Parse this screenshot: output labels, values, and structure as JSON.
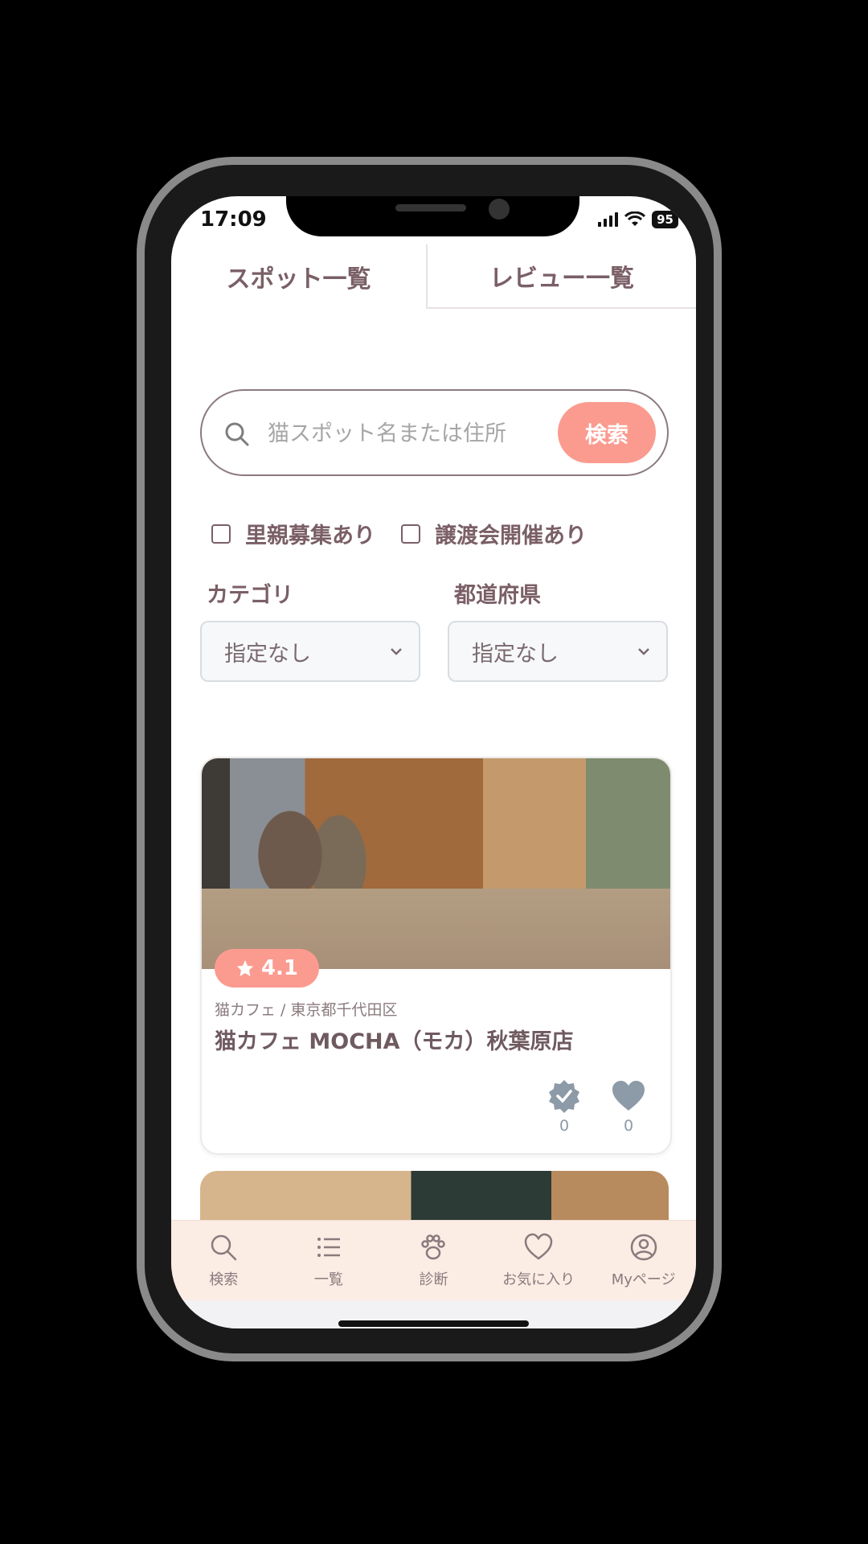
{
  "status": {
    "time": "17:09",
    "battery": "95"
  },
  "tabs": [
    {
      "label": "スポット一覧"
    },
    {
      "label": "レビュー一覧"
    }
  ],
  "search": {
    "placeholder": "猫スポット名または住所",
    "button_label": "検索"
  },
  "filters": {
    "checkboxes": [
      {
        "label": "里親募集あり"
      },
      {
        "label": "譲渡会開催あり"
      }
    ],
    "category": {
      "label": "カテゴリ",
      "value": "指定なし"
    },
    "prefecture": {
      "label": "都道府県",
      "value": "指定なし"
    }
  },
  "cards": [
    {
      "rating": "4.1",
      "meta": "猫カフェ / 東京都千代田区",
      "title": "猫カフェ MOCHA（モカ）秋葉原店",
      "visited_count": "0",
      "favorite_count": "0"
    }
  ],
  "nav": [
    {
      "label": "検索",
      "icon": "search-icon"
    },
    {
      "label": "一覧",
      "icon": "list-icon"
    },
    {
      "label": "診断",
      "icon": "paw-icon"
    },
    {
      "label": "お気に入り",
      "icon": "heart-icon"
    },
    {
      "label": "Myページ",
      "icon": "user-icon"
    }
  ],
  "colors": {
    "accent": "#fb9b8f",
    "text": "#7a5f66",
    "nav_bg": "#fbece4"
  }
}
